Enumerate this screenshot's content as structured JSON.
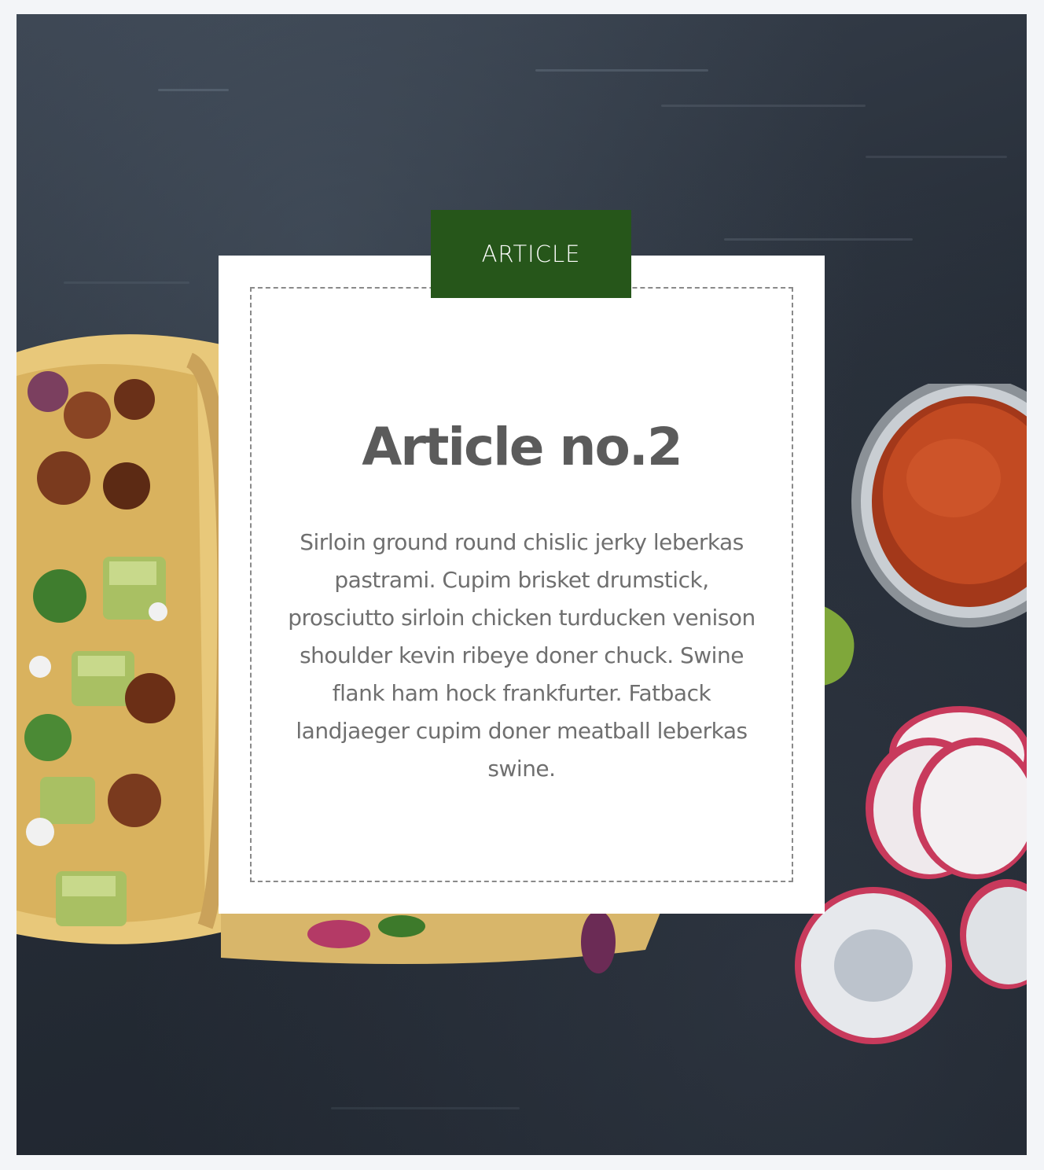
{
  "article": {
    "badge_label": "ARTICLE",
    "title": "Article no.2",
    "body": "Sirloin ground round chislic jerky leberkas pastrami. Cupim brisket drumstick, prosciutto sirloin chicken turducken venison shoulder kevin ribeye doner chuck. Swine flank ham hock frankfurter. Fatback landjaeger cupim doner meatball leberkas swine."
  },
  "colors": {
    "badge_background": "#26561a",
    "title_text": "#5b5b5b",
    "body_text": "#6f6f6f",
    "card_background": "#ffffff",
    "page_background": "#f3f5f8"
  },
  "background": {
    "icon": "tacos-food-photo"
  }
}
